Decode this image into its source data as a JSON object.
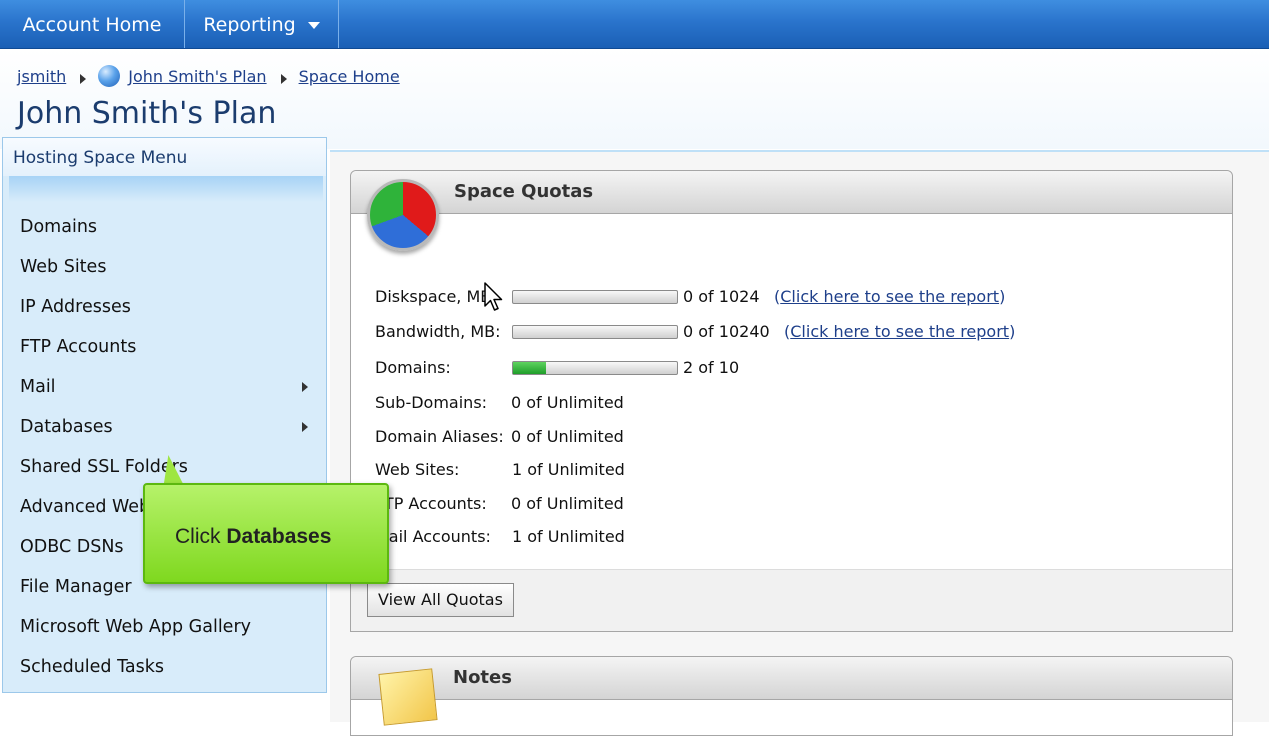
{
  "topnav": {
    "tabs": [
      {
        "label": "Account Home"
      },
      {
        "label": "Reporting"
      }
    ]
  },
  "breadcrumb": {
    "items": [
      {
        "label": "jsmith"
      },
      {
        "label": "John Smith's Plan"
      },
      {
        "label": "Space Home"
      }
    ]
  },
  "page": {
    "title": "John Smith's Plan"
  },
  "sidebar": {
    "title": "Hosting Space Menu",
    "items": [
      {
        "label": "Domains",
        "has_submenu": false
      },
      {
        "label": "Web Sites",
        "has_submenu": false
      },
      {
        "label": "IP Addresses",
        "has_submenu": false
      },
      {
        "label": "FTP Accounts",
        "has_submenu": false
      },
      {
        "label": "Mail",
        "has_submenu": true
      },
      {
        "label": "Databases",
        "has_submenu": true
      },
      {
        "label": "Shared SSL Folders",
        "has_submenu": false
      },
      {
        "label": "Advanced Web",
        "has_submenu": false
      },
      {
        "label": "ODBC DSNs",
        "has_submenu": false
      },
      {
        "label": "File Manager",
        "has_submenu": false
      },
      {
        "label": "Microsoft Web App Gallery",
        "has_submenu": false
      },
      {
        "label": "Scheduled Tasks",
        "has_submenu": false
      }
    ]
  },
  "quotas": {
    "title": "Space Quotas",
    "report_link": "Click here to see the report",
    "rows": [
      {
        "label": "Diskspace, MB:",
        "value": "0 of 1024",
        "used": 0,
        "max": 1024,
        "has_bar": true,
        "has_link": true
      },
      {
        "label": "Bandwidth, MB:",
        "value": "0 of 10240",
        "used": 0,
        "max": 10240,
        "has_bar": true,
        "has_link": true
      },
      {
        "label": "Domains:",
        "value": "2 of 10",
        "used": 2,
        "max": 10,
        "has_bar": true,
        "has_link": false
      },
      {
        "label": "Sub-Domains:",
        "value": "0 of Unlimited",
        "has_bar": false
      },
      {
        "label": "Domain Aliases:",
        "value": "0 of Unlimited",
        "has_bar": false
      },
      {
        "label": "Web Sites:",
        "value": "1 of Unlimited",
        "has_bar": false
      },
      {
        "label": "FTP Accounts:",
        "value": "0 of Unlimited",
        "has_bar": false
      },
      {
        "label": "Mail Accounts:",
        "value": "1 of Unlimited",
        "has_bar": false
      }
    ],
    "view_all_label": "View All Quotas"
  },
  "notes": {
    "title": "Notes"
  },
  "callout": {
    "prefix": "Click ",
    "emphasis": "Databases"
  },
  "colors": {
    "nav_blue": "#2a74cc",
    "sidebar_bg": "#d8ecfa",
    "bar_green": "#1f9e2a",
    "callout_green": "#7fd81f",
    "link_blue": "#1e3f8a"
  }
}
